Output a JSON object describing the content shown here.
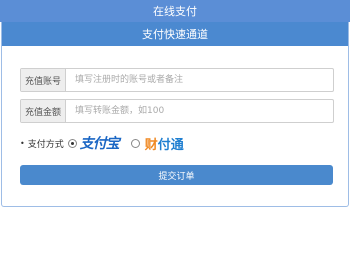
{
  "page": {
    "title": "在线支付"
  },
  "panel": {
    "header": "支付快速通道"
  },
  "form": {
    "account": {
      "label": "充值账号",
      "placeholder": "填写注册时的账号或者备注",
      "value": ""
    },
    "amount": {
      "label": "充值金额",
      "placeholder": "填写转账金额，如100",
      "value": ""
    },
    "payment": {
      "label": "支付方式",
      "options": [
        {
          "name": "支付宝",
          "selected": true,
          "brand_color": "#1a66c4"
        },
        {
          "name": "财付通",
          "selected": false,
          "brand_color": "#f08a24"
        }
      ]
    },
    "submit_label": "提交订单"
  }
}
